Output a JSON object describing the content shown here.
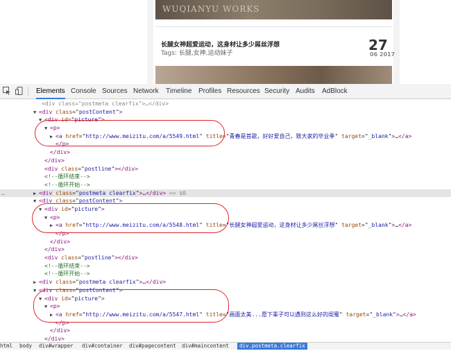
{
  "preview": {
    "banner_text": "WUQIANYU WORKS",
    "post_title": "长腿女神超爱运动，这身材让多少屌丝浮想",
    "post_tags": "Tags: 长腿,女神,运动妹子",
    "day": "27",
    "month_year": "06 2017"
  },
  "devtools": {
    "tabs": [
      "Elements",
      "Console",
      "Sources",
      "Network",
      "Timeline",
      "Profiles",
      "Resources",
      "Security",
      "Audits",
      "AdBlock"
    ],
    "active_tab": "Elements",
    "inspect_icon": "cursor-select-icon",
    "device_icon": "mobile-device-icon"
  },
  "tree": {
    "lines": [
      {
        "indent": 7,
        "tri": "",
        "parts": [
          [
            "tg",
            "<"
          ],
          [
            "tg",
            "div "
          ],
          [
            "an",
            "class"
          ],
          [
            "tx",
            "=\""
          ],
          [
            "av",
            "postContent"
          ],
          [
            "tx",
            "\""
          ],
          [
            "tg",
            ">"
          ]
        ],
        "arrow": "▼"
      },
      {
        "indent": 8,
        "arrow": "▼",
        "parts": [
          [
            "tg",
            "<div "
          ],
          [
            "an",
            "id"
          ],
          [
            "tx",
            "=\""
          ],
          [
            "av",
            "picture"
          ],
          [
            "tx",
            "\""
          ],
          [
            "tg",
            ">"
          ]
        ]
      },
      {
        "indent": 9,
        "arrow": "▼",
        "parts": [
          [
            "tg",
            "<p>"
          ]
        ]
      },
      {
        "indent": 10,
        "arrow": "▶",
        "parts": [
          [
            "tg",
            "<a "
          ],
          [
            "an",
            "href"
          ],
          [
            "tx",
            "=\""
          ],
          [
            "av",
            "http://www.meizitu.com/a/5549.html"
          ],
          [
            "tx",
            "\" "
          ],
          [
            "an",
            "title"
          ],
          [
            "tx",
            "=\""
          ],
          [
            "av",
            "青春是首歌，好好爱自己，致大家的毕业季"
          ],
          [
            "tx",
            "\" "
          ],
          [
            "an",
            "target"
          ],
          [
            "tx",
            "=\""
          ],
          [
            "av",
            "_blank"
          ],
          [
            "tx",
            "\""
          ],
          [
            "tg",
            ">"
          ],
          [
            "tx",
            "…"
          ],
          [
            "tg",
            "</a>"
          ]
        ]
      },
      {
        "indent": 10,
        "arrow": "",
        "parts": [
          [
            "tg",
            "</p>"
          ]
        ]
      },
      {
        "indent": 9,
        "arrow": "",
        "parts": [
          [
            "tg",
            "</div>"
          ]
        ]
      },
      {
        "indent": 8,
        "arrow": "",
        "parts": [
          [
            "tg",
            "</div>"
          ]
        ]
      },
      {
        "indent": 8,
        "arrow": "",
        "parts": [
          [
            "tg",
            "<div "
          ],
          [
            "an",
            "class"
          ],
          [
            "tx",
            "=\""
          ],
          [
            "av",
            "postline"
          ],
          [
            "tx",
            "\""
          ],
          [
            "tg",
            ">"
          ],
          [
            "tg",
            "</div>"
          ]
        ]
      },
      {
        "indent": 8,
        "arrow": "",
        "parts": [
          [
            "cm",
            "<!--循环结束-->"
          ]
        ]
      },
      {
        "indent": 8,
        "arrow": "",
        "parts": [
          [
            "cm",
            "<!--循环开始-->"
          ]
        ]
      },
      {
        "indent": 7,
        "arrow": "▶",
        "hl": true,
        "parts": [
          [
            "tg",
            "<div "
          ],
          [
            "an",
            "class"
          ],
          [
            "tx",
            "=\""
          ],
          [
            "av",
            "postmeta  clearfix"
          ],
          [
            "tx",
            "\""
          ],
          [
            "tg",
            ">"
          ],
          [
            "tx",
            "…"
          ],
          [
            "tg",
            "</div>"
          ],
          [
            "gray",
            " == $0"
          ]
        ]
      },
      {
        "indent": 7,
        "arrow": "▼",
        "parts": [
          [
            "tg",
            "<div "
          ],
          [
            "an",
            "class"
          ],
          [
            "tx",
            "=\""
          ],
          [
            "av",
            "postContent"
          ],
          [
            "tx",
            "\""
          ],
          [
            "tg",
            ">"
          ]
        ]
      },
      {
        "indent": 8,
        "arrow": "▼",
        "parts": [
          [
            "tg",
            "<div "
          ],
          [
            "an",
            "id"
          ],
          [
            "tx",
            "=\""
          ],
          [
            "av",
            "picture"
          ],
          [
            "tx",
            "\""
          ],
          [
            "tg",
            ">"
          ]
        ]
      },
      {
        "indent": 9,
        "arrow": "▼",
        "parts": [
          [
            "tg",
            "<p>"
          ]
        ]
      },
      {
        "indent": 10,
        "arrow": "▶",
        "parts": [
          [
            "tg",
            "<a "
          ],
          [
            "an",
            "href"
          ],
          [
            "tx",
            "=\""
          ],
          [
            "av",
            "http://www.meizitu.com/a/5548.html"
          ],
          [
            "tx",
            "\" "
          ],
          [
            "an",
            "title"
          ],
          [
            "tx",
            "=\""
          ],
          [
            "av",
            "长腿女神超爱运动，这身材让多少屌丝浮想"
          ],
          [
            "tx",
            "\" "
          ],
          [
            "an",
            "target"
          ],
          [
            "tx",
            "=\""
          ],
          [
            "av",
            "_blank"
          ],
          [
            "tx",
            "\""
          ],
          [
            "tg",
            ">"
          ],
          [
            "tx",
            "…"
          ],
          [
            "tg",
            "</a>"
          ]
        ]
      },
      {
        "indent": 10,
        "arrow": "",
        "parts": [
          [
            "tg",
            "</p>"
          ]
        ]
      },
      {
        "indent": 9,
        "arrow": "",
        "parts": [
          [
            "tg",
            "</div>"
          ]
        ]
      },
      {
        "indent": 8,
        "arrow": "",
        "parts": [
          [
            "tg",
            "</div>"
          ]
        ]
      },
      {
        "indent": 8,
        "arrow": "",
        "parts": [
          [
            "tg",
            "<div "
          ],
          [
            "an",
            "class"
          ],
          [
            "tx",
            "=\""
          ],
          [
            "av",
            "postline"
          ],
          [
            "tx",
            "\""
          ],
          [
            "tg",
            ">"
          ],
          [
            "tg",
            "</div>"
          ]
        ]
      },
      {
        "indent": 8,
        "arrow": "",
        "parts": [
          [
            "cm",
            "<!--循环结束-->"
          ]
        ]
      },
      {
        "indent": 8,
        "arrow": "",
        "parts": [
          [
            "cm",
            "<!--循环开始-->"
          ]
        ]
      },
      {
        "indent": 7,
        "arrow": "▶",
        "parts": [
          [
            "tg",
            "<div "
          ],
          [
            "an",
            "class"
          ],
          [
            "tx",
            "=\""
          ],
          [
            "av",
            "postmeta  clearfix"
          ],
          [
            "tx",
            "\""
          ],
          [
            "tg",
            ">"
          ],
          [
            "tx",
            "…"
          ],
          [
            "tg",
            "</div>"
          ]
        ]
      },
      {
        "indent": 7,
        "arrow": "▼",
        "parts": [
          [
            "tg",
            "<div "
          ],
          [
            "an",
            "class"
          ],
          [
            "tx",
            "=\""
          ],
          [
            "av",
            "postContent"
          ],
          [
            "tx",
            "\""
          ],
          [
            "tg",
            ">"
          ]
        ]
      },
      {
        "indent": 8,
        "arrow": "▼",
        "parts": [
          [
            "tg",
            "<div "
          ],
          [
            "an",
            "id"
          ],
          [
            "tx",
            "=\""
          ],
          [
            "av",
            "picture"
          ],
          [
            "tx",
            "\""
          ],
          [
            "tg",
            ">"
          ]
        ]
      },
      {
        "indent": 9,
        "arrow": "▼",
        "parts": [
          [
            "tg",
            "<p>"
          ]
        ]
      },
      {
        "indent": 10,
        "arrow": "▶",
        "parts": [
          [
            "tg",
            "<a "
          ],
          [
            "an",
            "href"
          ],
          [
            "tx",
            "=\""
          ],
          [
            "av",
            "http://www.meizitu.com/a/5547.html"
          ],
          [
            "tx",
            "\" "
          ],
          [
            "an",
            "title"
          ],
          [
            "tx",
            "=\""
          ],
          [
            "av",
            "画面太美...愿下辈子可以遇到这么好的闺蜜"
          ],
          [
            "tx",
            "\" "
          ],
          [
            "an",
            "target"
          ],
          [
            "tx",
            "=\""
          ],
          [
            "av",
            "_blank"
          ],
          [
            "tx",
            "\""
          ],
          [
            "tg",
            ">"
          ],
          [
            "tx",
            "…"
          ],
          [
            "tg",
            "</a>"
          ]
        ]
      },
      {
        "indent": 10,
        "arrow": "",
        "parts": [
          [
            "tg",
            "</p>"
          ]
        ]
      },
      {
        "indent": 9,
        "arrow": "",
        "parts": [
          [
            "tg",
            "</div>"
          ]
        ]
      },
      {
        "indent": 8,
        "arrow": "",
        "parts": [
          [
            "tg",
            "</div>"
          ]
        ]
      },
      {
        "indent": 8,
        "arrow": "",
        "parts": [
          [
            "tg",
            "<div "
          ],
          [
            "an",
            "class"
          ],
          [
            "tx",
            "=\""
          ],
          [
            "av",
            "postline"
          ],
          [
            "tx",
            "\""
          ],
          [
            "tg",
            ">"
          ],
          [
            "tg",
            "</div>"
          ]
        ]
      }
    ]
  },
  "breadcrumbs": [
    "html",
    "body",
    "div#wrapper",
    "div#container",
    "div#pagecontent",
    "div#maincontent",
    "div.postmeta.clearfix"
  ],
  "selected_crumb": "div.postmeta.clearfix"
}
